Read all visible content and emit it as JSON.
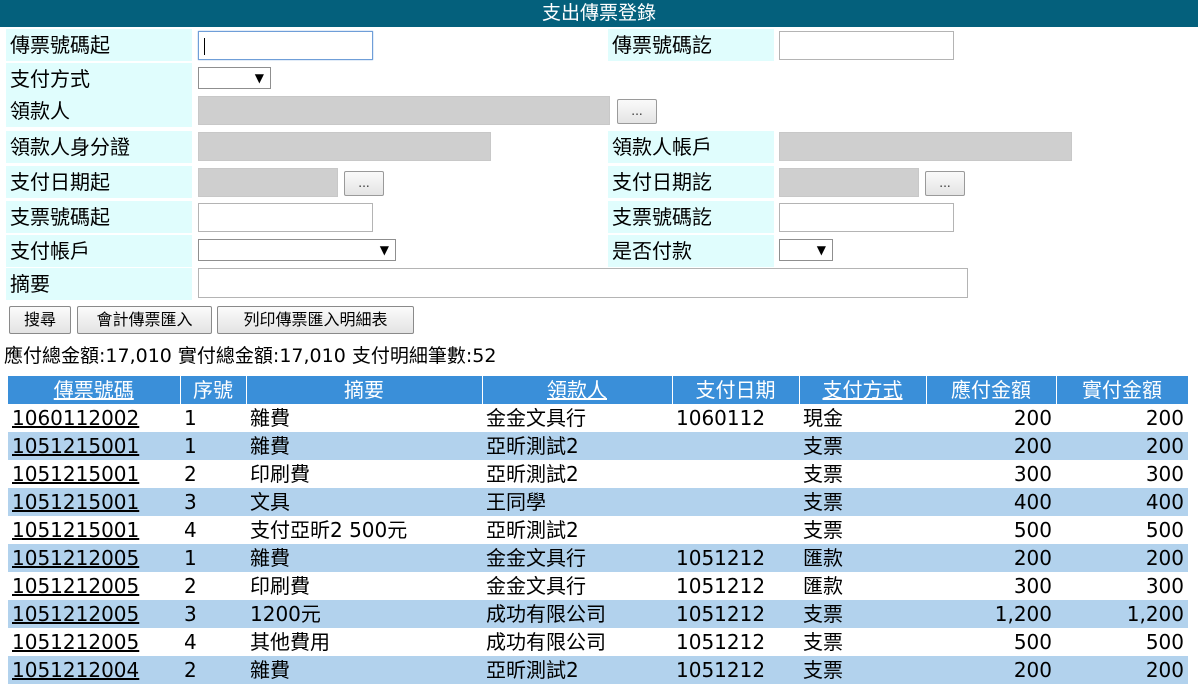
{
  "title": "支出傳票登錄",
  "form": {
    "voucher_no_from": {
      "label": "傳票號碼起",
      "value": ""
    },
    "voucher_no_to": {
      "label": "傳票號碼訖",
      "value": ""
    },
    "payment_method": {
      "label": "支付方式",
      "value": ""
    },
    "payee": {
      "label": "領款人",
      "value": "",
      "button": "..."
    },
    "payee_id": {
      "label": "領款人身分證",
      "value": ""
    },
    "payee_account": {
      "label": "領款人帳戶",
      "value": ""
    },
    "pay_date_from": {
      "label": "支付日期起",
      "value": "",
      "button": "..."
    },
    "pay_date_to": {
      "label": "支付日期訖",
      "value": "",
      "button": "..."
    },
    "check_no_from": {
      "label": "支票號碼起",
      "value": ""
    },
    "check_no_to": {
      "label": "支票號碼訖",
      "value": ""
    },
    "pay_account": {
      "label": "支付帳戶",
      "value": ""
    },
    "is_paid": {
      "label": "是否付款",
      "value": ""
    },
    "summary": {
      "label": "摘要",
      "value": ""
    }
  },
  "buttons": {
    "search": "搜尋",
    "import": "會計傳票匯入",
    "print": "列印傳票匯入明細表"
  },
  "totals": {
    "text": "應付總金額:17,010 實付總金額:17,010 支付明細筆數:52"
  },
  "table": {
    "columns": [
      "傳票號碼",
      "序號",
      "摘要",
      "領款人",
      "支付日期",
      "支付方式",
      "應付金額",
      "實付金額"
    ],
    "rows": [
      [
        "1060112002",
        "1",
        "雜費",
        "金金文具行",
        "1060112",
        "現金",
        "200",
        "200"
      ],
      [
        "1051215001",
        "1",
        "雜費",
        "亞昕測試2",
        "",
        "支票",
        "200",
        "200"
      ],
      [
        "1051215001",
        "2",
        "印刷費",
        "亞昕測試2",
        "",
        "支票",
        "300",
        "300"
      ],
      [
        "1051215001",
        "3",
        "文具",
        "王同學",
        "",
        "支票",
        "400",
        "400"
      ],
      [
        "1051215001",
        "4",
        "支付亞昕2 500元",
        "亞昕測試2",
        "",
        "支票",
        "500",
        "500"
      ],
      [
        "1051212005",
        "1",
        "雜費",
        "金金文具行",
        "1051212",
        "匯款",
        "200",
        "200"
      ],
      [
        "1051212005",
        "2",
        "印刷費",
        "金金文具行",
        "1051212",
        "匯款",
        "300",
        "300"
      ],
      [
        "1051212005",
        "3",
        "1200元",
        "成功有限公司",
        "1051212",
        "支票",
        "1,200",
        "1,200"
      ],
      [
        "1051212005",
        "4",
        "其他費用",
        "成功有限公司",
        "1051212",
        "支票",
        "500",
        "500"
      ],
      [
        "1051212004",
        "2",
        "雜費",
        "亞昕測試2",
        "1051212",
        "支票",
        "200",
        "200"
      ]
    ]
  },
  "colors": {
    "title_bar": "#04607c",
    "header": "#3a8fd9",
    "alt_row": "#b2d2ed",
    "label_bg": "#e0fdfd"
  }
}
